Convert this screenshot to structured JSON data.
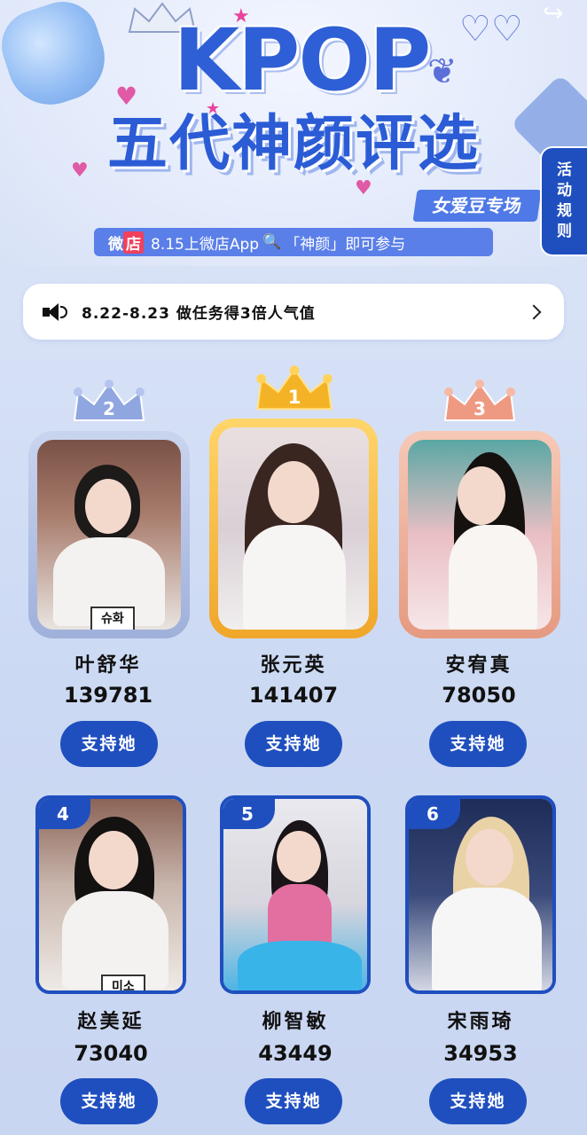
{
  "banner": {
    "kpop": "KPOP",
    "title": "五代神颜评选",
    "subtitle": "女爱豆专场",
    "info_weidian": "微",
    "info_dian": "店",
    "info_text": "8.15上微店App",
    "info_search": "🔍",
    "info_query": "「神颜」即可参与",
    "rules": [
      "活",
      "动",
      "规",
      "则"
    ]
  },
  "notice": {
    "text": "8.22-8.23 做任务得3倍人气值"
  },
  "podium": [
    {
      "rank": "2",
      "name": "叶舒华",
      "votes": "139781",
      "button": "支持她",
      "nameplate": "슈화"
    },
    {
      "rank": "1",
      "name": "张元英",
      "votes": "141407",
      "button": "支持她"
    },
    {
      "rank": "3",
      "name": "安宥真",
      "votes": "78050",
      "button": "支持她"
    }
  ],
  "ranking": [
    {
      "rank": "4",
      "name": "赵美延",
      "votes": "73040",
      "button": "支持她",
      "nameplate": "미소"
    },
    {
      "rank": "5",
      "name": "柳智敏",
      "votes": "43449",
      "button": "支持她"
    },
    {
      "rank": "6",
      "name": "宋雨琦",
      "votes": "34953",
      "button": "支持她"
    }
  ],
  "colors": {
    "primary": "#1f4fbf",
    "gold": "#f2b233",
    "silver": "#a9b8dc",
    "bronze": "#e9a58e"
  }
}
